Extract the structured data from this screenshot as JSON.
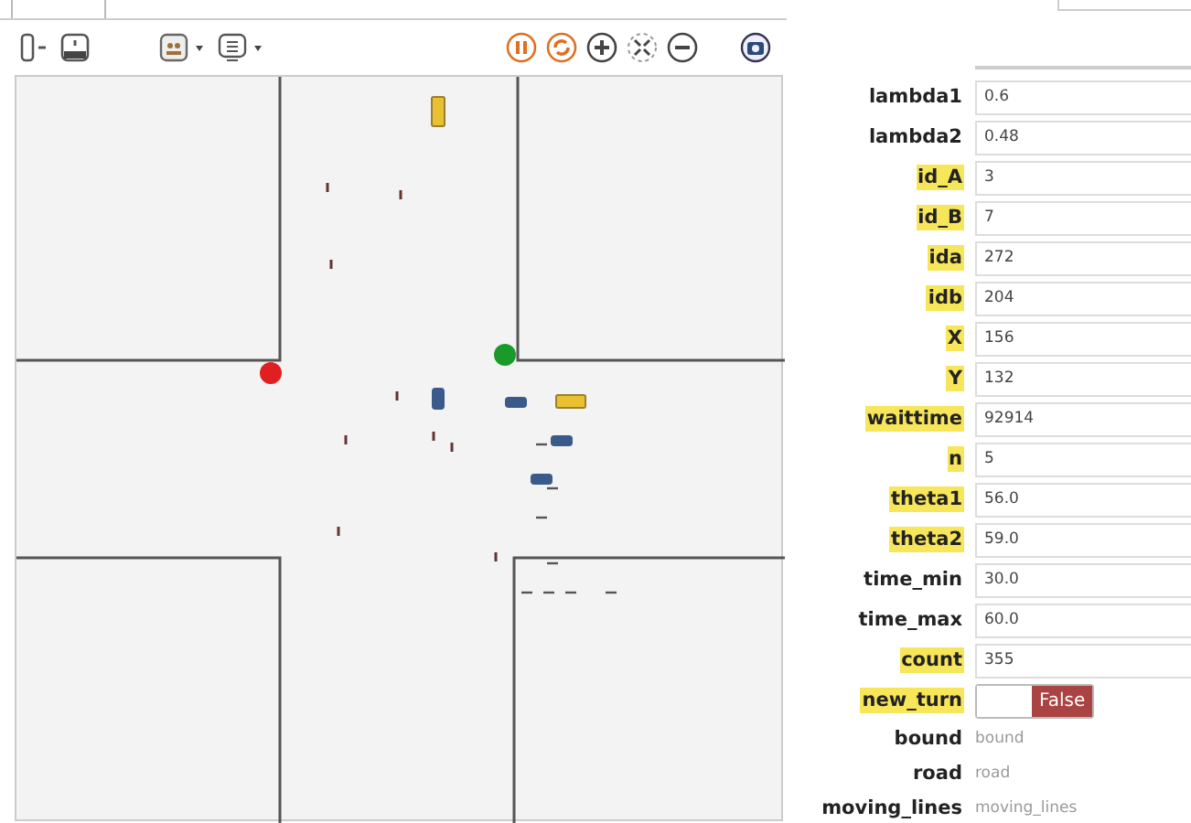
{
  "properties": [
    {
      "label": "lambda1",
      "highlighted": false,
      "kind": "field",
      "value": "0.6"
    },
    {
      "label": "lambda2",
      "highlighted": false,
      "kind": "field",
      "value": "0.48"
    },
    {
      "label": "id_A",
      "highlighted": true,
      "kind": "field",
      "value": "3"
    },
    {
      "label": "id_B",
      "highlighted": true,
      "kind": "field",
      "value": "7"
    },
    {
      "label": "ida",
      "highlighted": true,
      "kind": "field",
      "value": "272"
    },
    {
      "label": "idb",
      "highlighted": true,
      "kind": "field",
      "value": "204"
    },
    {
      "label": "X",
      "highlighted": true,
      "kind": "field",
      "value": "156"
    },
    {
      "label": "Y",
      "highlighted": true,
      "kind": "field",
      "value": "132"
    },
    {
      "label": "waittime",
      "highlighted": true,
      "kind": "field",
      "value": "92914"
    },
    {
      "label": "n",
      "highlighted": true,
      "kind": "field",
      "value": "5"
    },
    {
      "label": "theta1",
      "highlighted": true,
      "kind": "field",
      "value": "56.0"
    },
    {
      "label": "theta2",
      "highlighted": true,
      "kind": "field",
      "value": "59.0"
    },
    {
      "label": "time_min",
      "highlighted": false,
      "kind": "field",
      "value": "30.0"
    },
    {
      "label": "time_max",
      "highlighted": false,
      "kind": "field",
      "value": "60.0"
    },
    {
      "label": "count",
      "highlighted": true,
      "kind": "field",
      "value": "355"
    },
    {
      "label": "new_turn",
      "highlighted": true,
      "kind": "toggle",
      "on": false,
      "value": "False"
    },
    {
      "label": "bound",
      "highlighted": false,
      "kind": "text",
      "value": "bound"
    },
    {
      "label": "road",
      "highlighted": false,
      "kind": "text",
      "value": "road"
    },
    {
      "label": "moving_lines",
      "highlighted": false,
      "kind": "text",
      "value": "moving_lines"
    }
  ],
  "lights": [
    {
      "color": "#e02020"
    },
    {
      "color": "#1a9a2a"
    }
  ]
}
